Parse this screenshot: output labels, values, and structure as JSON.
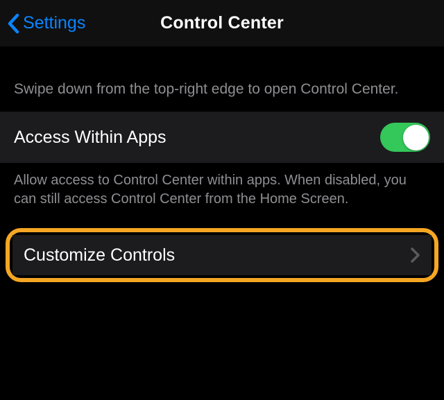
{
  "nav": {
    "back_label": "Settings",
    "title": "Control Center"
  },
  "intro_text": "Swipe down from the top-right edge to open Control Center.",
  "access_within_apps": {
    "label": "Access Within Apps",
    "toggle_on": true,
    "footnote": "Allow access to Control Center within apps. When disabled, you can still access Control Center from the Home Screen."
  },
  "customize": {
    "label": "Customize Controls"
  },
  "colors": {
    "accent_blue": "#0a84ff",
    "toggle_green": "#34c759",
    "highlight_orange": "#f5a623"
  }
}
